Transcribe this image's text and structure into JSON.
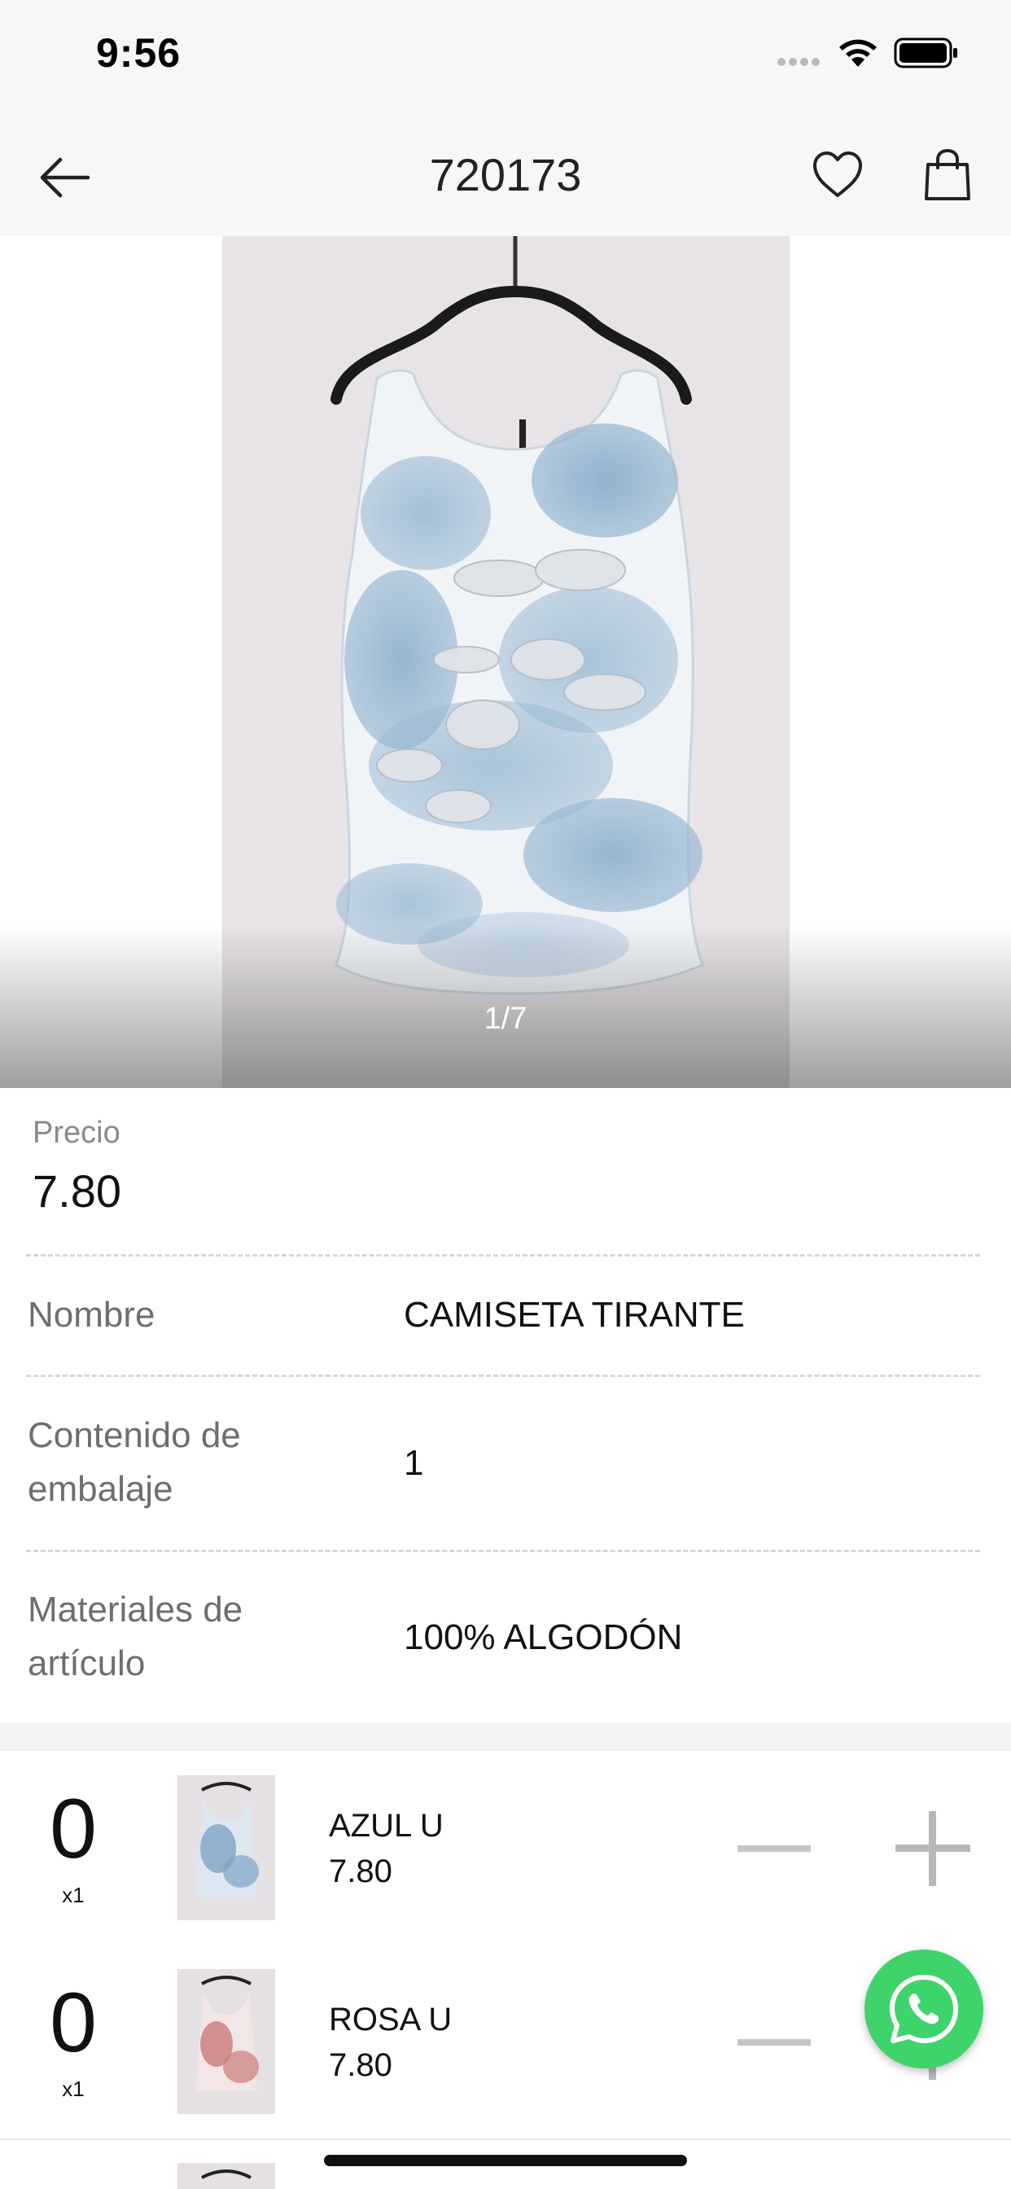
{
  "status_bar": {
    "time": "9:56"
  },
  "nav": {
    "title": "720173",
    "back_icon": "arrow-left-icon",
    "favorite_icon": "heart-icon",
    "cart_icon": "shopping-bag-icon"
  },
  "gallery": {
    "page_indicator": "1/7"
  },
  "details": {
    "price_label": "Precio",
    "price_value": "7.80",
    "rows": [
      {
        "label": "Nombre",
        "value": "CAMISETA TIRANTE"
      },
      {
        "label": "Contenido de embalaje",
        "value": "1"
      },
      {
        "label": "Materiales de artículo",
        "value": "100% ALGODÓN"
      }
    ]
  },
  "variants": [
    {
      "qty": "0",
      "multiplier": "x1",
      "name": "AZUL U",
      "price": "7.80",
      "color": "#7fa4c4"
    },
    {
      "qty": "0",
      "multiplier": "x1",
      "name": "ROSA U",
      "price": "7.80",
      "color": "#c97a7a"
    }
  ],
  "fab": {
    "icon": "whatsapp-icon",
    "color": "#3fd46b"
  }
}
